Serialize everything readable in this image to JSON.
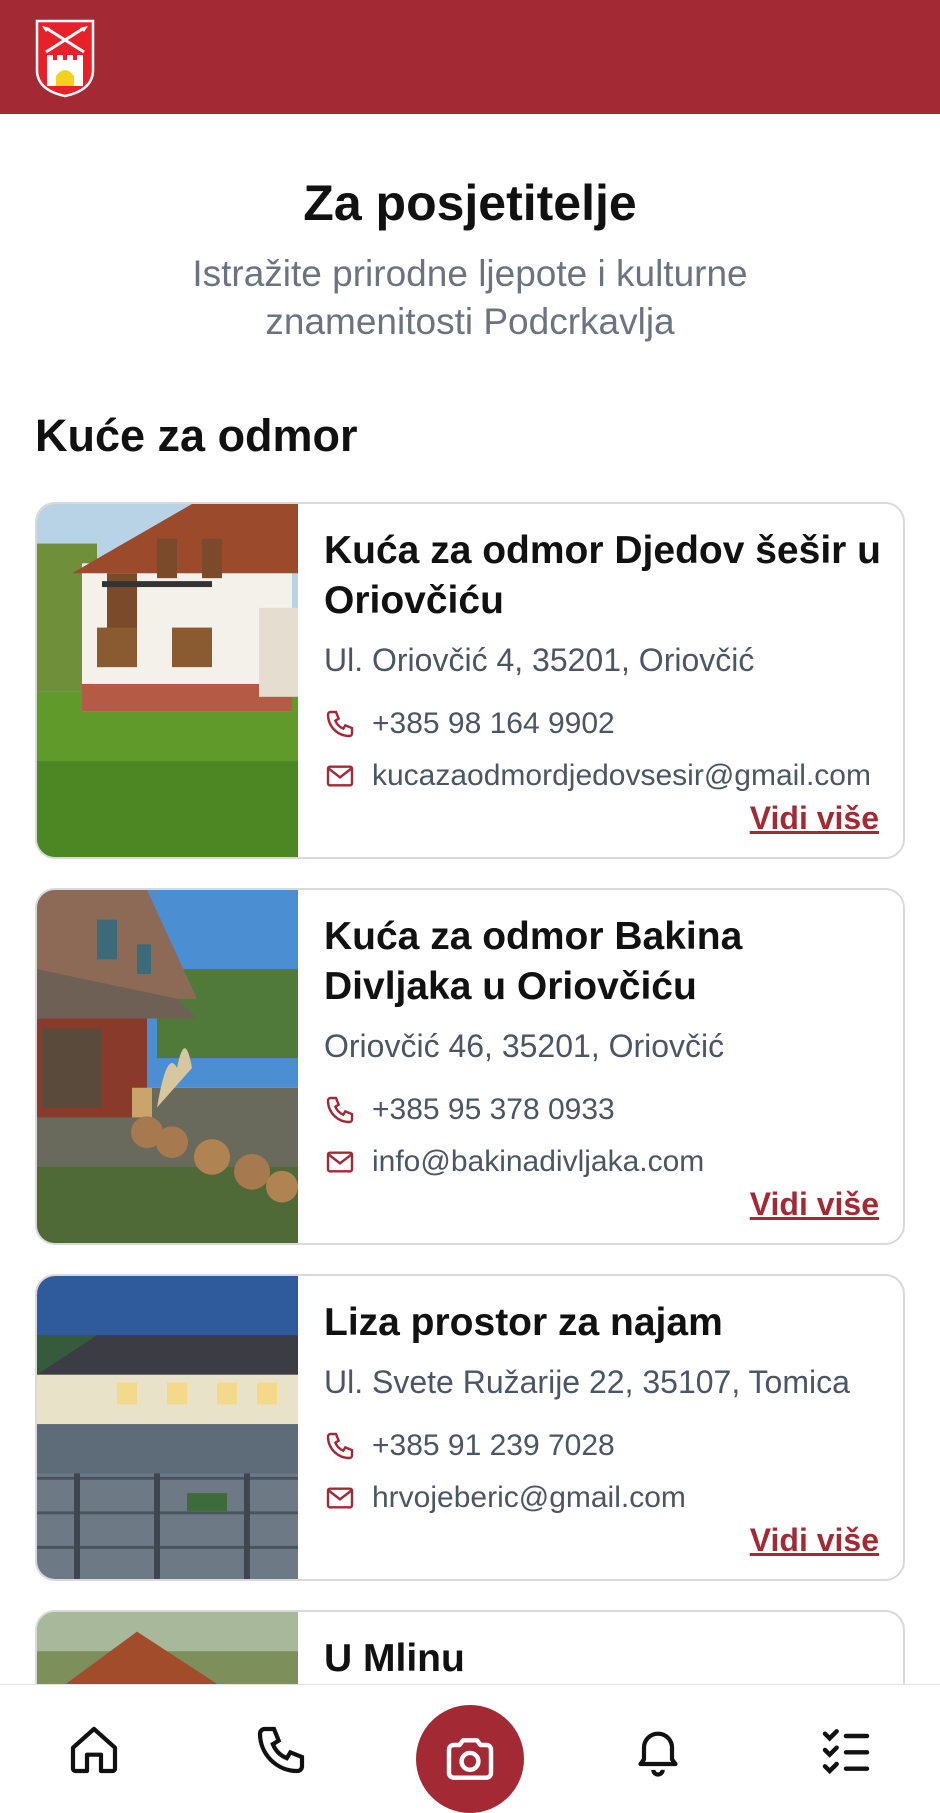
{
  "app": {
    "brand_color": "#a32a35",
    "logo_icon": "coat-of-arms-icon"
  },
  "header": {
    "title": "Za posjetitelje",
    "subtitle": "Istražite prirodne ljepote i kulturne znamenitosti Podcrkavlja"
  },
  "section": {
    "title": "Kuće za odmor"
  },
  "listings": [
    {
      "title": "Kuća za odmor Djedov šešir u Oriovčiću",
      "address": " Ul. Oriovčić 4, 35201, Oriovčić",
      "phone": "+385 98 164 9902",
      "email": "kucazaodmordjedovsesir@gmail.com",
      "link": "Vidi više"
    },
    {
      "title": "Kuća za odmor Bakina Divljaka u Oriovčiću",
      "address": "Oriovčić 46, 35201, Oriovčić",
      "phone": "+385 95 378 0933",
      "email": "info@bakinadivljaka.com",
      "link": "Vidi više"
    },
    {
      "title": "Liza prostor za najam",
      "address": "Ul. Svete Ružarije 22, 35107, Tomica",
      "phone": "+385 91 239 7028",
      "email": "hrvojeberic@gmail.com",
      "link": "Vidi više"
    },
    {
      "title": "U Mlinu"
    }
  ],
  "nav": {
    "items": [
      "home-icon",
      "phone-icon",
      "camera-icon",
      "bell-icon",
      "checklist-icon"
    ]
  }
}
